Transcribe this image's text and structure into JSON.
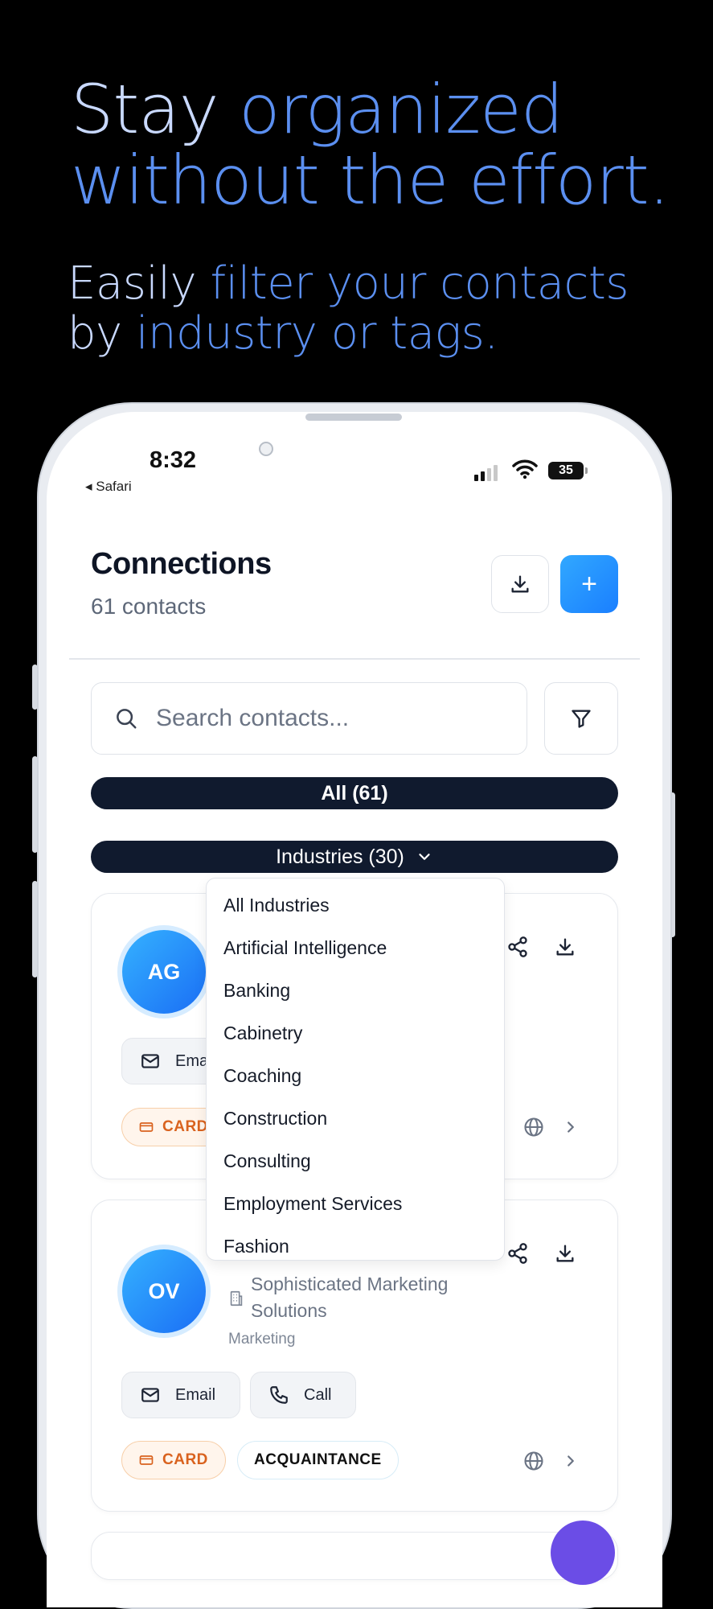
{
  "promo": {
    "headline_line1_a": "Stay ",
    "headline_line1_b": "organized",
    "headline_line2": "without the effort.",
    "sub_line1_a": "Easily ",
    "sub_line1_b": "filter your contacts",
    "sub_line2_a": "by ",
    "sub_line2_b": "industry or tags."
  },
  "status_bar": {
    "time": "8:32",
    "back_app": "◂ Safari",
    "battery": "35"
  },
  "header": {
    "title": "Connections",
    "count": "61 contacts",
    "add_symbol": "+"
  },
  "search": {
    "placeholder": "Search contacts..."
  },
  "filters": {
    "all_label": "All (61)",
    "industries_label": "Industries (30)"
  },
  "dropdown": {
    "items": [
      "All Industries",
      "Artificial Intelligence",
      "Banking",
      "Cabinetry",
      "Coaching",
      "Construction",
      "Consulting",
      "Employment Services",
      "Fashion"
    ]
  },
  "contacts": [
    {
      "initials": "AG",
      "email_label": "Email",
      "card_tag": "CARD"
    },
    {
      "initials": "OV",
      "company": "Sophisticated Marketing Solutions",
      "company_line1": "Sophisticated Marketing",
      "company_line2": "Solutions",
      "industry": "Marketing",
      "email_label": "Email",
      "call_label": "Call",
      "card_tag": "CARD",
      "relation_tag": "ACQUAINTANCE"
    }
  ],
  "colors": {
    "accent_blue": "#1a7fff",
    "headline_blue": "#5b8ff0",
    "headline_light": "#c9d9ff",
    "pill_dark": "#101a2e",
    "tag_orange": "#d9621e"
  },
  "icons": [
    "download-icon",
    "plus-icon",
    "search-icon",
    "filter-icon",
    "chevron-down-icon",
    "share-icon",
    "mail-icon",
    "phone-icon",
    "globe-icon",
    "chevron-right-icon",
    "card-icon",
    "building-icon",
    "wifi-icon",
    "signal-icon"
  ]
}
